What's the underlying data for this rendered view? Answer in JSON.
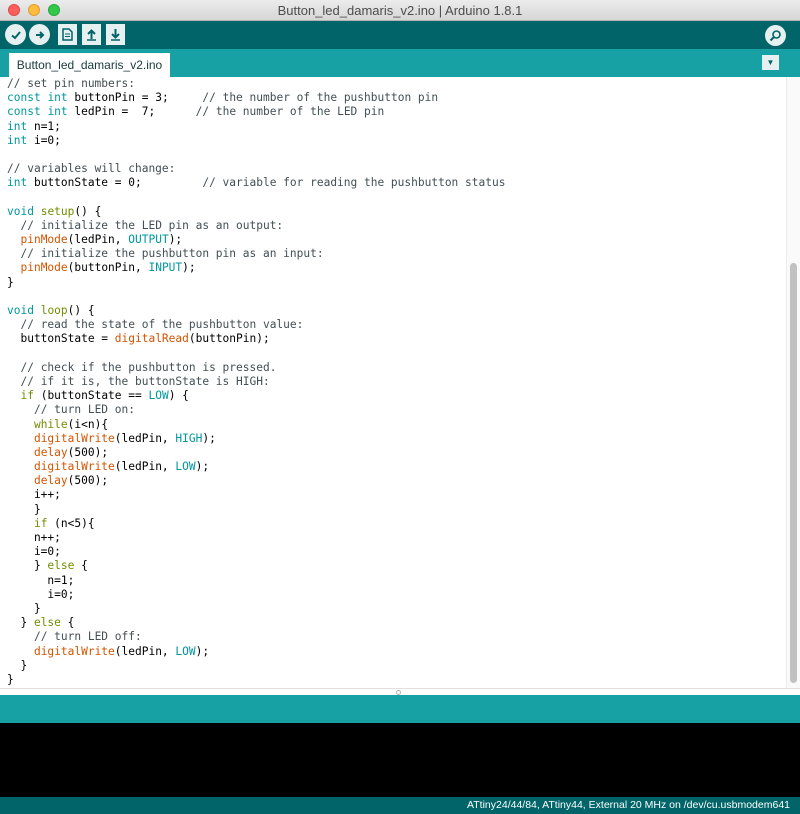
{
  "window": {
    "title": "Button_led_damaris_v2.ino | Arduino 1.8.1"
  },
  "toolbar": {
    "verify_icon": "check-icon",
    "upload_icon": "arrow-right-icon",
    "new_icon": "document-icon",
    "open_icon": "arrow-up-icon",
    "save_icon": "arrow-down-icon",
    "serial_monitor_icon": "magnifier-icon"
  },
  "tabs": [
    {
      "label": "Button_led_damaris_v2.ino"
    }
  ],
  "colors": {
    "comment": "#434f54",
    "keyword_type": "#00979c",
    "function": "#d35400",
    "constant": "#00979c",
    "control": "#728e00",
    "toolbar": "#006468",
    "tabbar": "#17a1a5"
  },
  "code_lines": [
    [
      [
        "c",
        "// set pin numbers:"
      ]
    ],
    [
      [
        "k",
        "const"
      ],
      [
        "p",
        " "
      ],
      [
        "k",
        "int"
      ],
      [
        "p",
        " buttonPin = 3;     "
      ],
      [
        "c",
        "// the number of the pushbutton pin"
      ]
    ],
    [
      [
        "k",
        "const"
      ],
      [
        "p",
        " "
      ],
      [
        "k",
        "int"
      ],
      [
        "p",
        " ledPin =  7;      "
      ],
      [
        "c",
        "// the number of the LED pin"
      ]
    ],
    [
      [
        "k",
        "int"
      ],
      [
        "p",
        " n=1;"
      ]
    ],
    [
      [
        "k",
        "int"
      ],
      [
        "p",
        " i=0;"
      ]
    ],
    [
      [
        "p",
        ""
      ]
    ],
    [
      [
        "c",
        "// variables will change:"
      ]
    ],
    [
      [
        "k",
        "int"
      ],
      [
        "p",
        " buttonState = 0;         "
      ],
      [
        "c",
        "// variable for reading the pushbutton status"
      ]
    ],
    [
      [
        "p",
        ""
      ]
    ],
    [
      [
        "k",
        "void"
      ],
      [
        "p",
        " "
      ],
      [
        "s",
        "setup"
      ],
      [
        "p",
        "() {"
      ]
    ],
    [
      [
        "p",
        "  "
      ],
      [
        "c",
        "// initialize the LED pin as an output:"
      ]
    ],
    [
      [
        "p",
        "  "
      ],
      [
        "f",
        "pinMode"
      ],
      [
        "p",
        "(ledPin, "
      ],
      [
        "k",
        "OUTPUT"
      ],
      [
        "p",
        ");"
      ]
    ],
    [
      [
        "p",
        "  "
      ],
      [
        "c",
        "// initialize the pushbutton pin as an input:"
      ]
    ],
    [
      [
        "p",
        "  "
      ],
      [
        "f",
        "pinMode"
      ],
      [
        "p",
        "(buttonPin, "
      ],
      [
        "k",
        "INPUT"
      ],
      [
        "p",
        ");"
      ]
    ],
    [
      [
        "p",
        "}"
      ]
    ],
    [
      [
        "p",
        ""
      ]
    ],
    [
      [
        "k",
        "void"
      ],
      [
        "p",
        " "
      ],
      [
        "s",
        "loop"
      ],
      [
        "p",
        "() {"
      ]
    ],
    [
      [
        "p",
        "  "
      ],
      [
        "c",
        "// read the state of the pushbutton value:"
      ]
    ],
    [
      [
        "p",
        "  buttonState = "
      ],
      [
        "f",
        "digitalRead"
      ],
      [
        "p",
        "(buttonPin);"
      ]
    ],
    [
      [
        "p",
        ""
      ]
    ],
    [
      [
        "p",
        "  "
      ],
      [
        "c",
        "// check if the pushbutton is pressed."
      ]
    ],
    [
      [
        "p",
        "  "
      ],
      [
        "c",
        "// if it is, the buttonState is HIGH:"
      ]
    ],
    [
      [
        "p",
        "  "
      ],
      [
        "s",
        "if"
      ],
      [
        "p",
        " (buttonState == "
      ],
      [
        "k",
        "LOW"
      ],
      [
        "p",
        ") {"
      ]
    ],
    [
      [
        "p",
        "    "
      ],
      [
        "c",
        "// turn LED on:"
      ]
    ],
    [
      [
        "p",
        "    "
      ],
      [
        "s",
        "while"
      ],
      [
        "p",
        "(i<n){"
      ]
    ],
    [
      [
        "p",
        "    "
      ],
      [
        "f",
        "digitalWrite"
      ],
      [
        "p",
        "(ledPin, "
      ],
      [
        "k",
        "HIGH"
      ],
      [
        "p",
        ");"
      ]
    ],
    [
      [
        "p",
        "    "
      ],
      [
        "f",
        "delay"
      ],
      [
        "p",
        "(500);"
      ]
    ],
    [
      [
        "p",
        "    "
      ],
      [
        "f",
        "digitalWrite"
      ],
      [
        "p",
        "(ledPin, "
      ],
      [
        "k",
        "LOW"
      ],
      [
        "p",
        ");"
      ]
    ],
    [
      [
        "p",
        "    "
      ],
      [
        "f",
        "delay"
      ],
      [
        "p",
        "(500);"
      ]
    ],
    [
      [
        "p",
        "    i++;"
      ]
    ],
    [
      [
        "p",
        "    }"
      ]
    ],
    [
      [
        "p",
        "    "
      ],
      [
        "s",
        "if"
      ],
      [
        "p",
        " (n<5){"
      ]
    ],
    [
      [
        "p",
        "    n++;"
      ]
    ],
    [
      [
        "p",
        "    i=0;"
      ]
    ],
    [
      [
        "p",
        "    } "
      ],
      [
        "s",
        "else"
      ],
      [
        "p",
        " {"
      ]
    ],
    [
      [
        "p",
        "      n=1;"
      ]
    ],
    [
      [
        "p",
        "      i=0;"
      ]
    ],
    [
      [
        "p",
        "    }"
      ]
    ],
    [
      [
        "p",
        "  } "
      ],
      [
        "s",
        "else"
      ],
      [
        "p",
        " {"
      ]
    ],
    [
      [
        "p",
        "    "
      ],
      [
        "c",
        "// turn LED off:"
      ]
    ],
    [
      [
        "p",
        "    "
      ],
      [
        "f",
        "digitalWrite"
      ],
      [
        "p",
        "(ledPin, "
      ],
      [
        "k",
        "LOW"
      ],
      [
        "p",
        ");"
      ]
    ],
    [
      [
        "p",
        "  }"
      ]
    ],
    [
      [
        "p",
        "}"
      ]
    ]
  ],
  "status_bar": {
    "board_info": "ATtiny24/44/84, ATtiny44, External 20 MHz on /dev/cu.usbmodem641"
  }
}
